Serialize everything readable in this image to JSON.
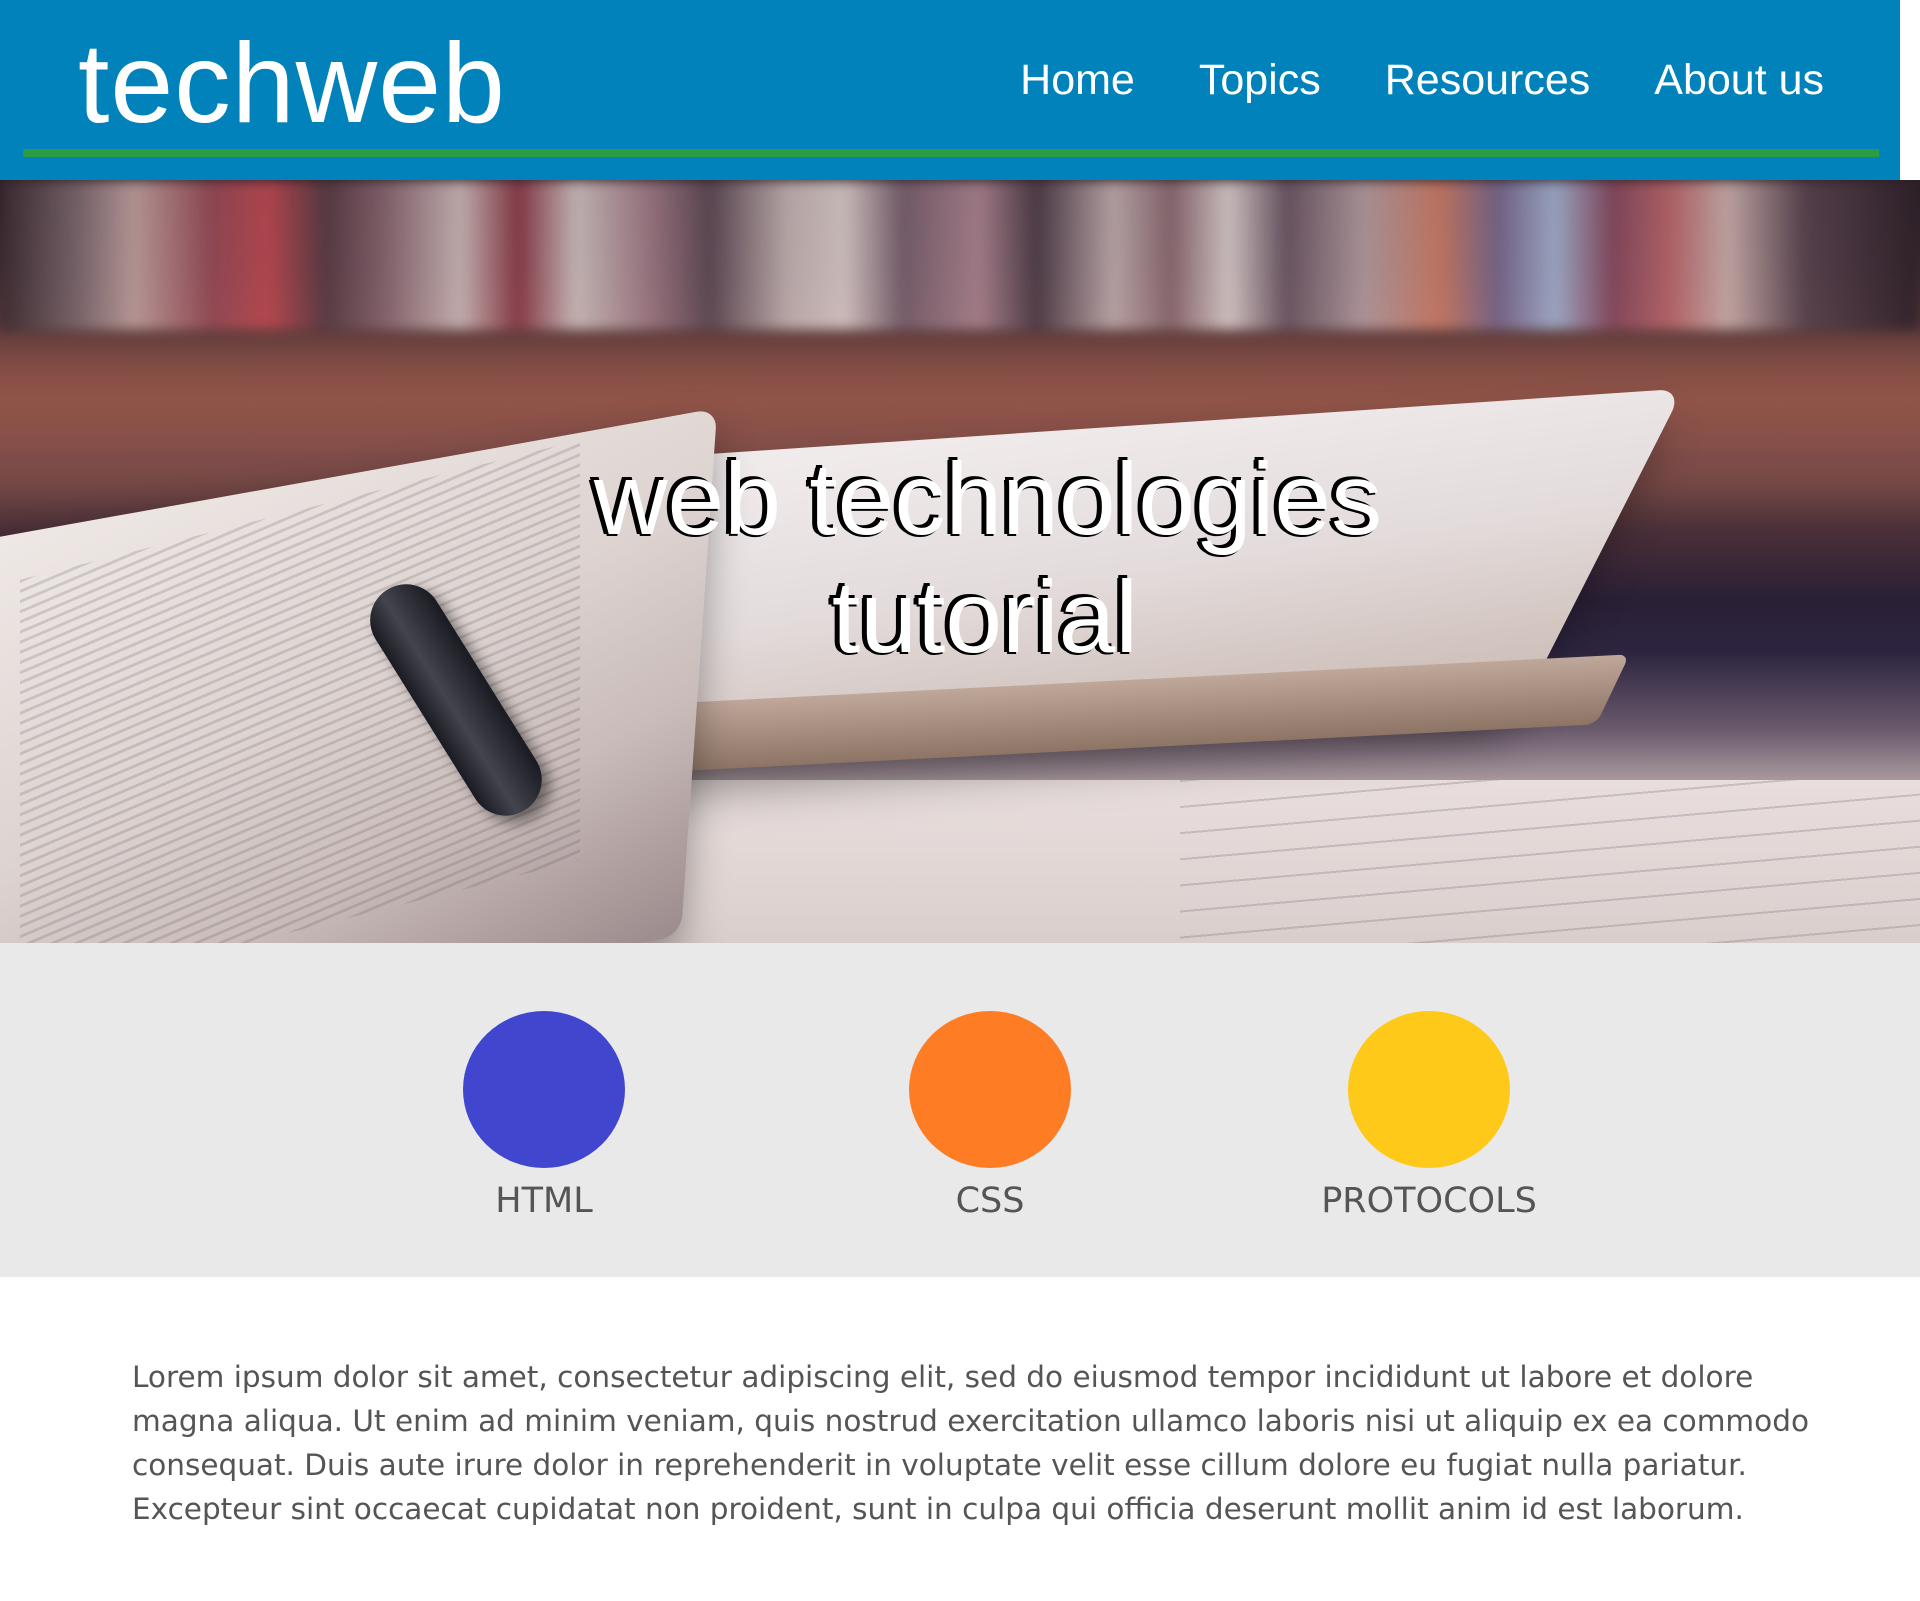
{
  "header": {
    "logo": "techweb",
    "bg_color": "#0282ba",
    "accent_line_color": "#2d9d43",
    "nav": [
      {
        "label": "Home"
      },
      {
        "label": "Topics"
      },
      {
        "label": "Resources"
      },
      {
        "label": "About us"
      }
    ]
  },
  "hero": {
    "title_line1": "web technologies",
    "title_line2": "tutorial",
    "image": "open-book-with-pen-photo"
  },
  "topics": {
    "bg_color": "#e9e9e9",
    "items": [
      {
        "label": "HTML",
        "color": "#4146cf"
      },
      {
        "label": "CSS",
        "color": "#fe7c24"
      },
      {
        "label": "PROTOCOLS",
        "color": "#fec919"
      }
    ]
  },
  "content": {
    "paragraph": "Lorem ipsum dolor sit amet, consectetur adipiscing elit, sed do eiusmod tempor incididunt ut labore et dolore magna aliqua. Ut enim ad minim veniam, quis nostrud exercitation ullamco laboris nisi ut aliquip ex ea commodo consequat. Duis aute irure dolor in reprehenderit in voluptate velit esse cillum dolore eu fugiat nulla pariatur. Excepteur sint occaecat cupidatat non proident, sunt in culpa qui officia deserunt mollit anim id est laborum."
  }
}
